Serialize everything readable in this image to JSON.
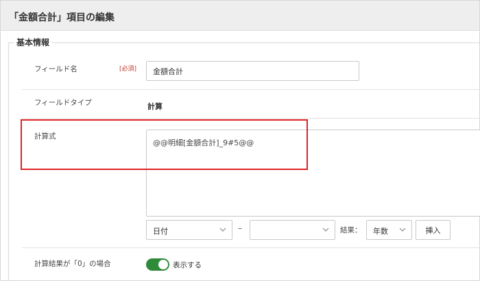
{
  "dialog": {
    "title": "「金額合計」項目の編集"
  },
  "section": {
    "legend": "基本情報"
  },
  "field_name": {
    "label": "フィールド名",
    "required": "[必須]",
    "value": "金額合計"
  },
  "field_type": {
    "label": "フィールドタイプ",
    "value": "計算"
  },
  "formula": {
    "label": "計算式",
    "value": "@@明細[金額合計]_9#5@@",
    "highlight_color": "#e02020"
  },
  "formula_tools": {
    "select1_value": "日付",
    "dash": "–",
    "select2_value": "",
    "result_label": "結果：",
    "select3_value": "年数",
    "insert_label": "挿入"
  },
  "zero_result": {
    "label": "計算結果が「0」の場合",
    "toggle_label": "表示する",
    "toggle_on": true,
    "toggle_color": "#2e8b3a"
  },
  "icons": {
    "select_chevron": "chevron-down-icon"
  }
}
